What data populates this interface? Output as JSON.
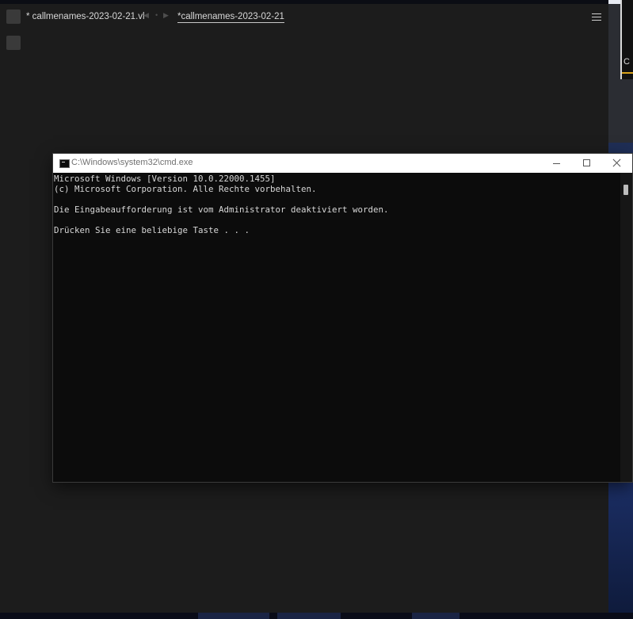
{
  "editor": {
    "tabs": [
      {
        "label": "* callmenames-2023-02-21.vl"
      },
      {
        "label": "*callmenames-2023-02-21"
      }
    ],
    "nav": {
      "back": "◀",
      "dot": "•",
      "forward": "▶"
    },
    "tab_chevron": "⌄"
  },
  "cmd": {
    "title": "C:\\Windows\\system32\\cmd.exe",
    "lines": [
      "Microsoft Windows [Version 10.0.22000.1455]",
      "(c) Microsoft Corporation. Alle Rechte vorbehalten.",
      "",
      "Die Eingabeaufforderung ist vom Administrator deaktiviert worden.",
      "",
      "Drücken Sie eine beliebige Taste . . ."
    ]
  },
  "desktop": {
    "edge_letter": "C"
  },
  "icons": {
    "menu": "hamburger-menu-icon",
    "cmd": "command-prompt-icon",
    "minimize": "minimize-icon",
    "maximize": "maximize-icon",
    "close": "close-icon"
  },
  "colors": {
    "editor_bg": "#1c1c1c",
    "console_bg": "#0c0c0c",
    "console_text": "#d7d7d7",
    "titlebar_bg": "#ffffff"
  }
}
